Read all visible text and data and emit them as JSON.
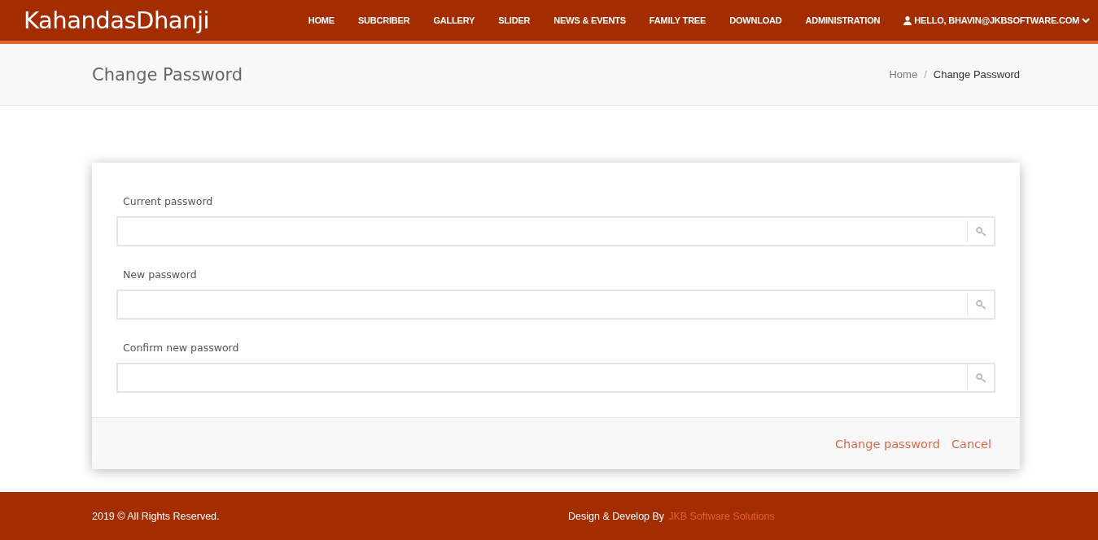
{
  "header": {
    "brand": "KahandasDhanji",
    "nav": [
      "HOME",
      "SUBCRIBER",
      "GALLERY",
      "SLIDER",
      "NEWS & EVENTS",
      "FAMILY TREE",
      "DOWNLOAD",
      "ADMINISTRATION"
    ],
    "user": "HELLO, BHAVIN@JKBSOFTWARE.COM"
  },
  "title_bar": {
    "title": "Change Password",
    "breadcrumb": [
      "Home",
      "Change Password"
    ],
    "breadcrumb_separator": "/"
  },
  "form": {
    "fields": [
      {
        "label": "Current password"
      },
      {
        "label": "New password"
      },
      {
        "label": "Confirm new password"
      }
    ],
    "actions": [
      "Change password",
      "Cancel"
    ]
  },
  "footer": {
    "copyright": "2019 © All Rights Reserved.",
    "credit": "Design & Develop By",
    "credit_link": "JKB Software Solutions"
  }
}
